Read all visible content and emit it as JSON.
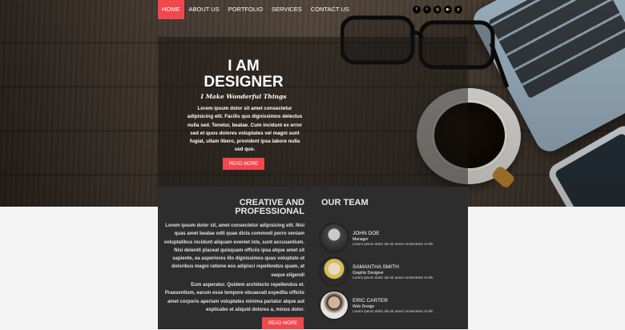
{
  "nav": {
    "items": [
      {
        "label": "HOME",
        "active": true
      },
      {
        "label": "ABOUT US",
        "active": false
      },
      {
        "label": "PORTFOLIO",
        "active": false
      },
      {
        "label": "SERVICES",
        "active": false
      },
      {
        "label": "CONTACT US",
        "active": false
      }
    ]
  },
  "social": [
    {
      "icon": "facebook-icon",
      "glyph": "f"
    },
    {
      "icon": "twitter-icon",
      "glyph": "t"
    },
    {
      "icon": "instagram-icon",
      "glyph": "◎"
    },
    {
      "icon": "youtube-icon",
      "glyph": "▶"
    },
    {
      "icon": "pinterest-icon",
      "glyph": "p"
    }
  ],
  "hero": {
    "title_line1": "I AM",
    "title_line2": "DESIGNER",
    "tagline": "I Make Wonderful Things",
    "body": "Lorem ipsum dolor sit amet consectetur adipisicing elit. Facilis quo dignissimos delectus nulla sed. Tenetur, beatae. Cum incidunt ex error sed et quos dolores voluptates vel magni sunt fugiat, ullam libero, provident ipsa labore nulla sed quo.",
    "button": "READ MORE"
  },
  "about": {
    "title_line1": "CREATIVE AND",
    "title_line2": "PROFESSIONAL",
    "paragraph1": "Lorem ipsum dolor sit, amet consectetur adipisicing elit. Nisi quas amet beatae odit quae dicta commodi porro veniam voluptatibus incidunt aliquam eveniet iste, sunt accusantium. Nisi deleniti placeat quisquam officiis ipsa atque amet sit sapiente, ea asperiores illo dignissimos quas voluptate ut doloribus magni ratione eos adipisci repellendus quam, at eaque eligendi",
    "paragraph2": "Eum asperatur. Quidem architecto repellendus et. Praesentium, earum esse tempore obcaecati expedita officiis amet corporis aperiam voluptates minima pariatur atque aut explicabo et aliquid dolores a, minus dolor.",
    "button": "READ MORE"
  },
  "team": {
    "title": "OUR TEAM",
    "members": [
      {
        "name": "JOHN DOE",
        "role": "Manager",
        "text": "Lorem ipsum dolor dut sit amet consectetur si elit."
      },
      {
        "name": "SAMANTHA SMITH",
        "role": "Graphic Designer",
        "text": "Lorem ipsum dolor dut sit amet consectetur si elit."
      },
      {
        "name": "ERIC CARTER",
        "role": "Web Design",
        "text": "Lorem ipsum dolor dut sit amet consectetur si elit."
      }
    ]
  },
  "colors": {
    "accent": "#f0484c",
    "card_dark": "#2d2d2d"
  }
}
